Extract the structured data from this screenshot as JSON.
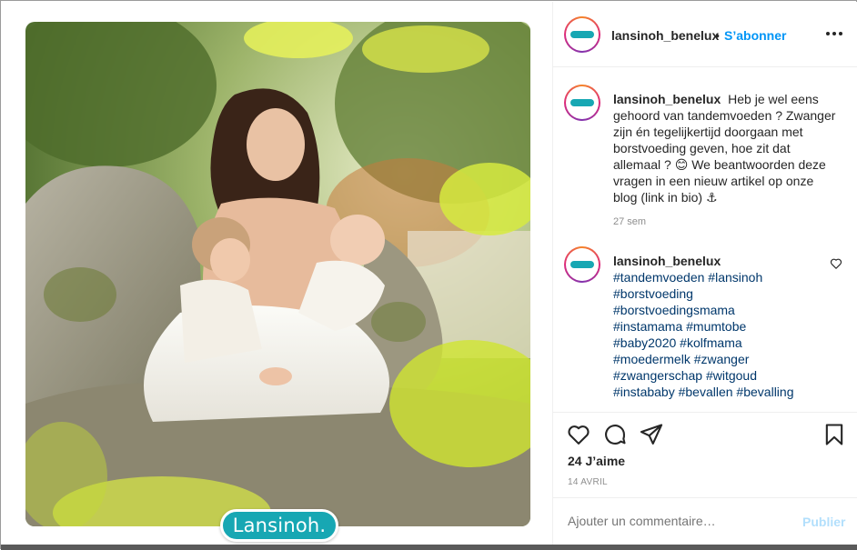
{
  "post": {
    "account": "lansinoh_benelux",
    "follow_separator": "•",
    "follow_label": "S’abonner",
    "brand_logo": "Lansinoh.",
    "caption": {
      "username": "lansinoh_benelux",
      "text": "Heb je wel eens gehoord van tandemvoeden ? Zwanger zijn én tegelijkertijd doorgaan met borstvoeding geven, hoe zit dat allemaal ? 😊 We beantwoorden deze vragen in een nieuw artikel op onze blog (link in bio) ⚓",
      "time": "27 sem"
    },
    "hashtag_comment": {
      "username": "lansinoh_benelux",
      "lines": [
        "#tandemvoeden #lansinoh",
        "#borstvoeding",
        "#borstvoedingsmama",
        "#instamama #mumtobe",
        "#baby2020 #kolfmama",
        "#moedermelk #zwanger",
        "#zwangerschap #witgoud",
        "#instababy #bevallen #bevalling"
      ]
    },
    "likes": "24 J’aime",
    "date": "14 AVRIL",
    "comment_placeholder": "Ajouter un commentaire…",
    "publish_label": "Publier"
  },
  "icons": {
    "like": "heart-icon",
    "comment": "comment-icon",
    "share": "paper-plane-icon",
    "save": "bookmark-icon",
    "more": "more-options-icon",
    "comment_like": "small-heart-icon"
  },
  "colors": {
    "link_blue": "#0095f6",
    "hashtag": "#00376b",
    "brand_teal": "#17a7b3",
    "muted": "#8e8e8e"
  }
}
